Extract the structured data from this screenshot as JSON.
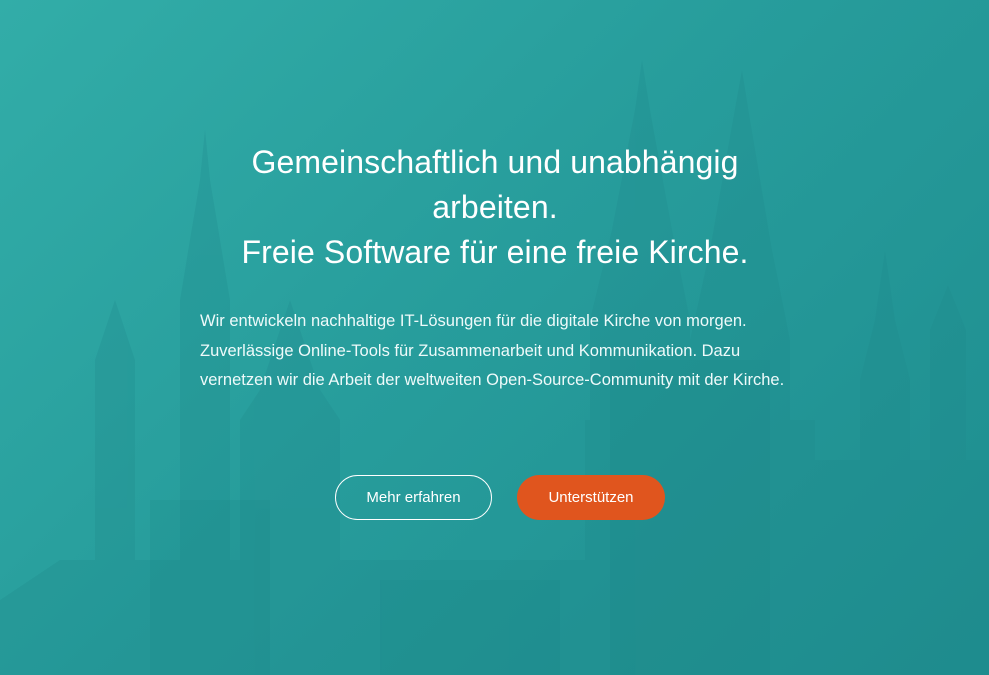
{
  "hero": {
    "headline_line1": "Gemeinschaftlich und unabhängig",
    "headline_line2": "arbeiten.",
    "headline_line3": "Freie Software für eine freie Kirche.",
    "lead": "Wir entwickeln nachhaltige IT-Lösungen für die digitale Kirche von morgen. Zuverlässige Online-Tools für Zusammenarbeit und Kommunikation. Dazu vernetzen wir die Arbeit der weltweiten Open-Source-Community mit der Kirche."
  },
  "actions": {
    "learn_more_label": "Mehr erfahren",
    "support_label": "Unterstützen"
  },
  "colors": {
    "background_start": "#32ada8",
    "background_end": "#1e8d8f",
    "accent": "#e0551e",
    "text": "#ffffff"
  },
  "icons": {
    "background_image": "church-skyline-silhouette"
  }
}
